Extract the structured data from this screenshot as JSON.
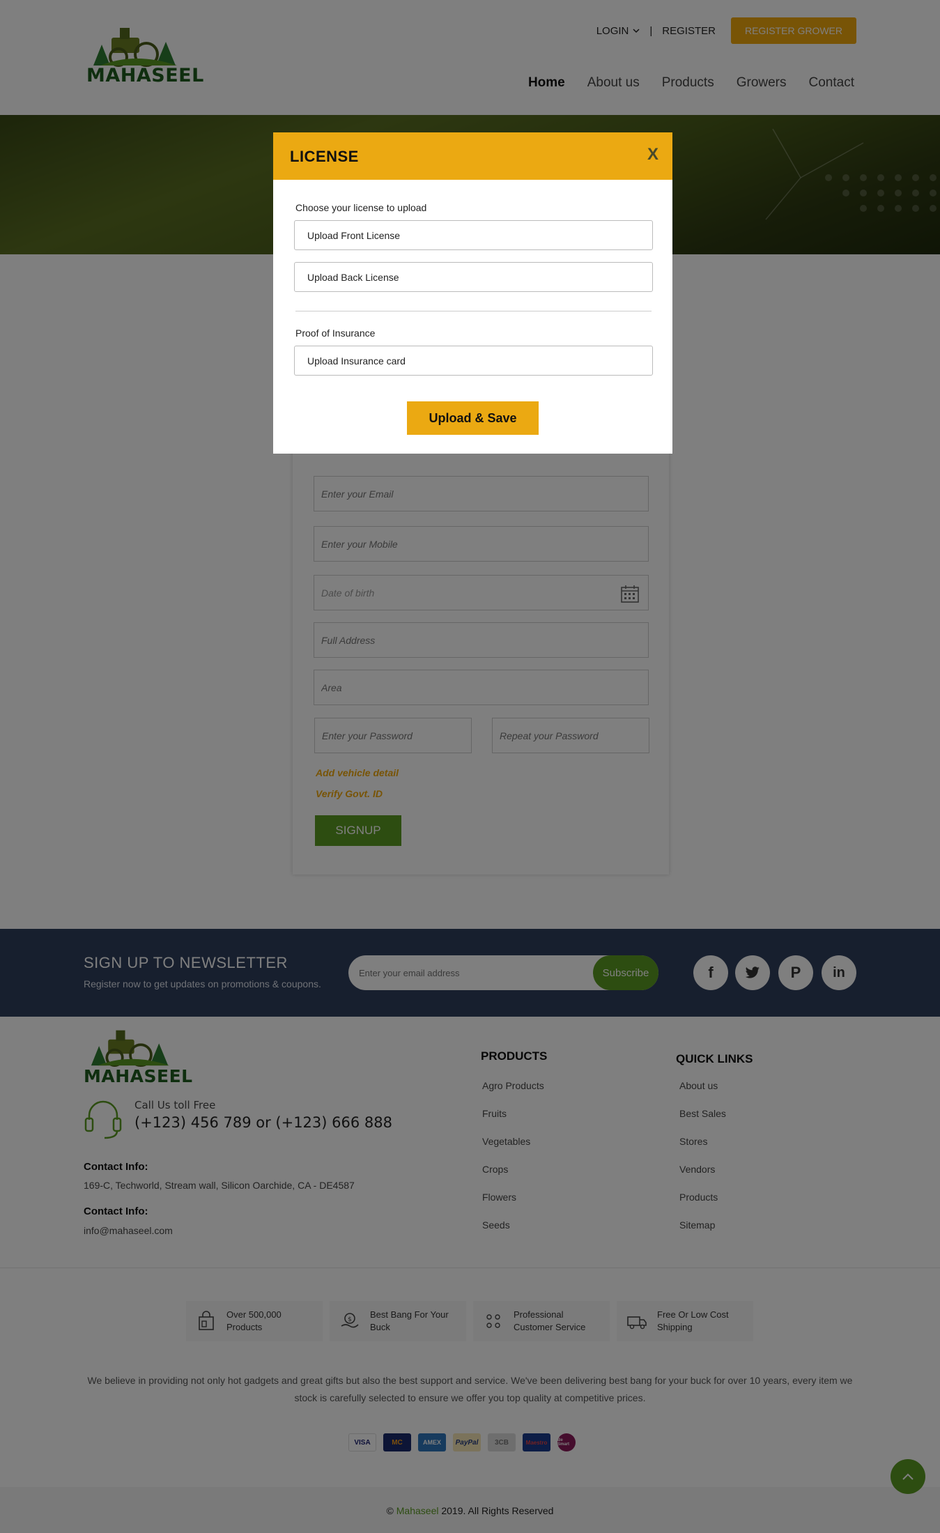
{
  "header": {
    "logo_text": "MAHASEEL",
    "login_label": "LOGIN",
    "separator": "|",
    "register_label": "REGISTER",
    "register_grower_label": "REGISTER GROWER",
    "nav": [
      "Home",
      "About us",
      "Products",
      "Growers",
      "Contact"
    ],
    "active_nav": "Home"
  },
  "form": {
    "email_placeholder": "Enter your Email",
    "mobile_placeholder": "Enter your Mobile",
    "dob_placeholder": "Date of birth",
    "address_placeholder": "Full Address",
    "area_placeholder": "Area",
    "password_placeholder": "Enter your Password",
    "repeat_password_placeholder": "Repeat your Password",
    "add_vehicle_link": "Add vehicle detail",
    "verify_id_link": "Verify Govt. ID",
    "signup_label": "SIGNUP"
  },
  "newsletter": {
    "title": "SIGN UP TO NEWSLETTER",
    "subtitle": "Register now to get updates on promotions & coupons.",
    "input_placeholder": "Enter your email address",
    "subscribe_label": "Subscribe",
    "social": [
      {
        "icon": "facebook-icon",
        "glyph": "f"
      },
      {
        "icon": "twitter-icon",
        "glyph": "t"
      },
      {
        "icon": "pinterest-icon",
        "glyph": "P"
      },
      {
        "icon": "linkedin-icon",
        "glyph": "in"
      }
    ]
  },
  "footer": {
    "logo_text": "MAHASEEL",
    "call_label": "Call Us toll Free",
    "call_numbers": "(+123) 456 789 or (+123) 666 888",
    "contact_title_1": "Contact Info:",
    "contact_address": "169-C, Techworld, Stream wall, Silicon Oarchide, CA - DE4587",
    "contact_title_2": "Contact Info:",
    "contact_email": "info@mahaseel.com",
    "products_title": "PRODUCTS",
    "products": [
      "Agro Products",
      "Fruits",
      "Vegetables",
      "Crops",
      "Flowers",
      "Seeds"
    ],
    "quick_links_title": "QUICK LINKS",
    "quick_links": [
      "About us",
      "Best Sales",
      "Stores",
      "Vendors",
      "Products",
      "Sitemap"
    ],
    "features": [
      {
        "icon": "shopping-bag-icon",
        "text": "Over 500,000 Products"
      },
      {
        "icon": "money-hand-icon",
        "text": "Best Bang For Your Buck"
      },
      {
        "icon": "customer-service-icon",
        "text": "Professional Customer Service"
      },
      {
        "icon": "shipping-truck-icon",
        "text": "Free Or Low Cost Shipping"
      }
    ],
    "about_text": "We believe in providing not only hot gadgets and great gifts but also the best support and service. We've been delivering best bang for your buck for over 10 years, every item we stock is carefully selected to ensure we offer you top quality at competitive prices.",
    "payments": [
      "VISA",
      "MC",
      "AMEX",
      "PayPal",
      "3CB",
      "Maestro",
      "Be Smart"
    ],
    "copyright_prefix": "©",
    "copyright_brand": "Mahaseel",
    "copyright_suffix": "2019. All Rights Reserved"
  },
  "modal": {
    "title": "LICENSE",
    "close_label": "X",
    "license_label": "Choose your license to upload",
    "front_label": "Upload Front License",
    "back_label": "Upload Back License",
    "insurance_label": "Proof of Insurance",
    "insurance_upload_label": "Upload Insurance card",
    "save_label": "Upload & Save"
  },
  "colors": {
    "accent_yellow": "#eba912",
    "brand_green": "#5b9a22",
    "newsletter_bg": "#2f3e5c"
  }
}
